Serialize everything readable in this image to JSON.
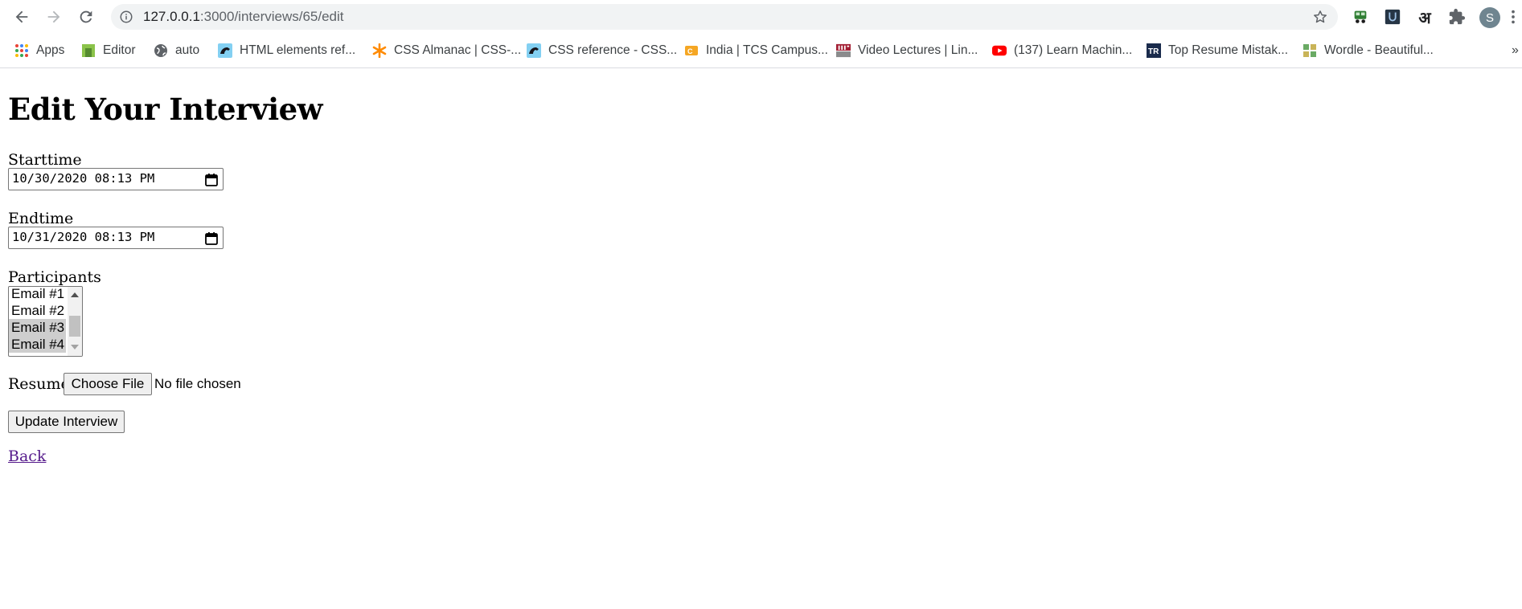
{
  "browser": {
    "url_host": "127.0.0.1",
    "url_rest": ":3000/interviews/65/edit",
    "avatar_letter": "S",
    "extension_devanagari": "अ",
    "overflow_chevron": "»",
    "bookmarks": [
      {
        "label": "Apps",
        "icon": "apps-grid-icon"
      },
      {
        "label": "Editor",
        "icon": "editor-favicon"
      },
      {
        "label": "auto",
        "icon": "globe-icon"
      },
      {
        "label": "HTML elements ref...",
        "icon": "mdn-favicon"
      },
      {
        "label": "CSS Almanac | CSS-...",
        "icon": "css-tricks-favicon"
      },
      {
        "label": "CSS reference - CSS...",
        "icon": "mdn-favicon"
      },
      {
        "label": "India | TCS Campus...",
        "icon": "tcs-favicon"
      },
      {
        "label": "Video Lectures | Lin...",
        "icon": "mit-ocw-favicon"
      },
      {
        "label": "(137) Learn Machin...",
        "icon": "youtube-favicon"
      },
      {
        "label": "Top Resume Mistak...",
        "icon": "tr-favicon"
      },
      {
        "label": "Wordle - Beautiful...",
        "icon": "wordle-favicon"
      }
    ]
  },
  "page": {
    "heading": "Edit Your Interview",
    "starttime": {
      "label": "Starttime",
      "value": "10/30/2020 08:13 PM"
    },
    "endtime": {
      "label": "Endtime",
      "value": "10/31/2020 08:13 PM"
    },
    "participants": {
      "label": "Participants",
      "options": [
        {
          "label": "Email #1",
          "selected": false
        },
        {
          "label": "Email #2",
          "selected": false
        },
        {
          "label": "Email #3",
          "selected": true
        },
        {
          "label": "Email #4",
          "selected": true
        }
      ]
    },
    "resume": {
      "label": "Resume",
      "button": "Choose File",
      "status": "No file chosen"
    },
    "submit_label": "Update Interview",
    "back_label": "Back"
  }
}
